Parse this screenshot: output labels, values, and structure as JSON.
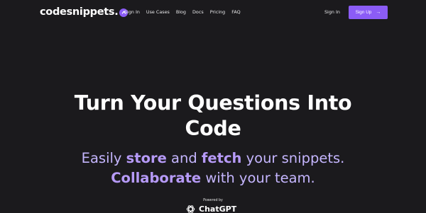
{
  "brand": {
    "name": "codesnippets.",
    "badge_icon": "caret-up-icon",
    "accent": "#8b5cf6"
  },
  "nav": {
    "links": [
      "Sign In",
      "Use Cases",
      "Blog",
      "Docs",
      "Pricing",
      "FAQ"
    ],
    "signin_label": "Sign In",
    "signup_label": "Sign Up",
    "signup_icon": "arrow-right-icon"
  },
  "hero": {
    "title_line1": "Turn Your Questions Into",
    "title_line2": "Code",
    "sub_1": "Easily ",
    "sub_store": "store",
    "sub_2": " and ",
    "sub_fetch": "fetch",
    "sub_3": " your snippets.",
    "sub_collab": "Collaborate",
    "sub_4": " with your team."
  },
  "powered": {
    "label": "Powered by",
    "product": "ChatGPT",
    "icon": "openai-logo-icon"
  }
}
